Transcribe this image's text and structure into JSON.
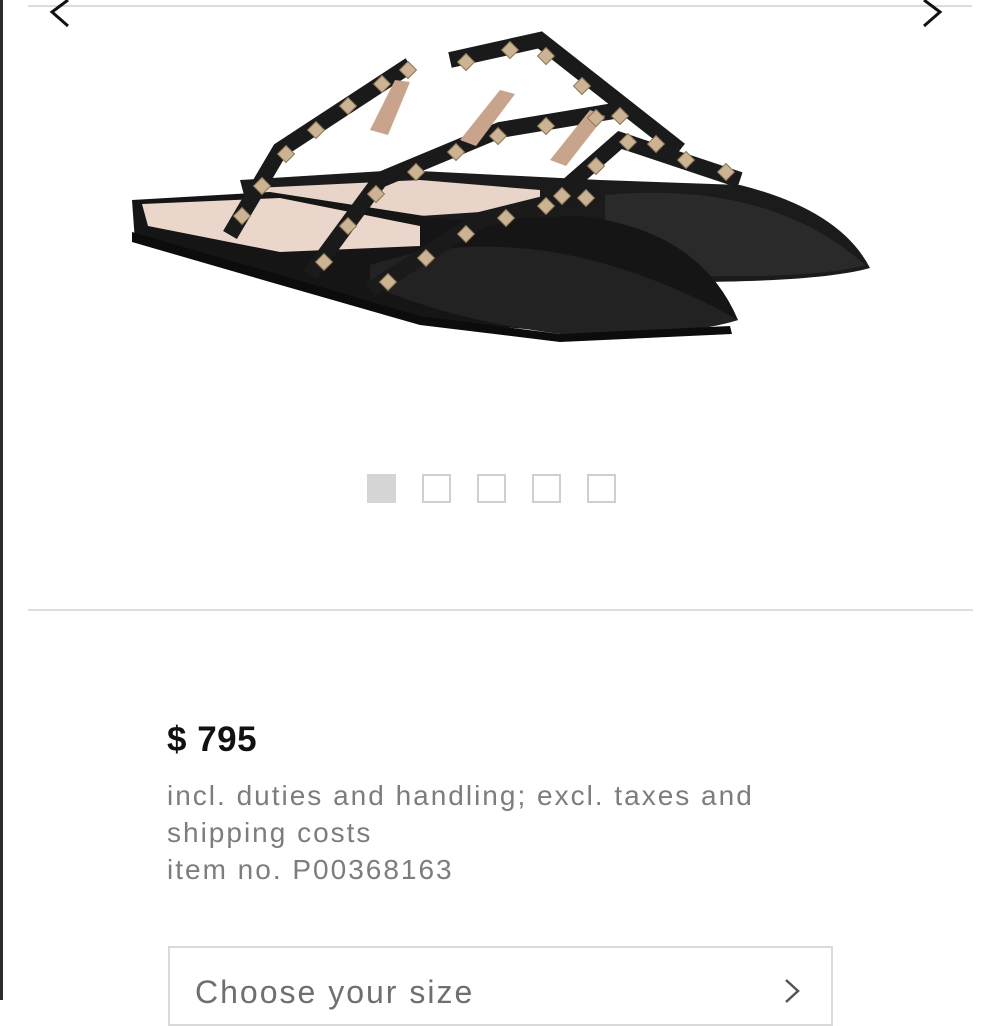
{
  "gallery": {
    "image_alt": "Black studded leather pointed-toe slide flats",
    "slide_count": 5,
    "active_slide": 1
  },
  "product": {
    "price": "$ 795",
    "duties_note_line1": "incl. duties and handling; excl. taxes and",
    "duties_note_line2": "shipping costs",
    "item_number": "item no. P00368163"
  },
  "size_selector": {
    "label": "Choose your size"
  },
  "icons": {
    "prev": "chevron-left-icon",
    "next": "chevron-right-icon",
    "size_arrow": "chevron-right-icon"
  },
  "colors": {
    "text_primary": "#111111",
    "text_secondary": "#7d7d7d",
    "divider": "#dedede",
    "dot_active": "#d5d5d5"
  }
}
